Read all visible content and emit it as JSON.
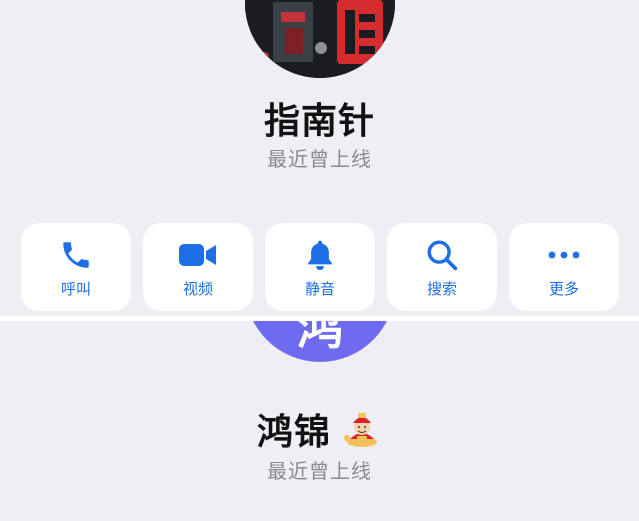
{
  "profile_top": {
    "name": "指南针",
    "status": "最近曾上线"
  },
  "actions": [
    {
      "label": "呼叫",
      "icon": "phone-icon"
    },
    {
      "label": "视频",
      "icon": "video-camera-icon"
    },
    {
      "label": "静音",
      "icon": "bell-icon"
    },
    {
      "label": "搜索",
      "icon": "search-icon"
    },
    {
      "label": "更多",
      "icon": "more-dots-icon"
    }
  ],
  "profile_bottom": {
    "name": "鸿锦",
    "status": "最近曾上线",
    "avatar_glyph": "鸿",
    "avatar_color": "#6e6bf1",
    "name_badge": "god-of-wealth-emoji"
  },
  "colors": {
    "accent": "#1e6fe6",
    "background": "#eeeef4",
    "status_text": "#8a8a8f"
  }
}
